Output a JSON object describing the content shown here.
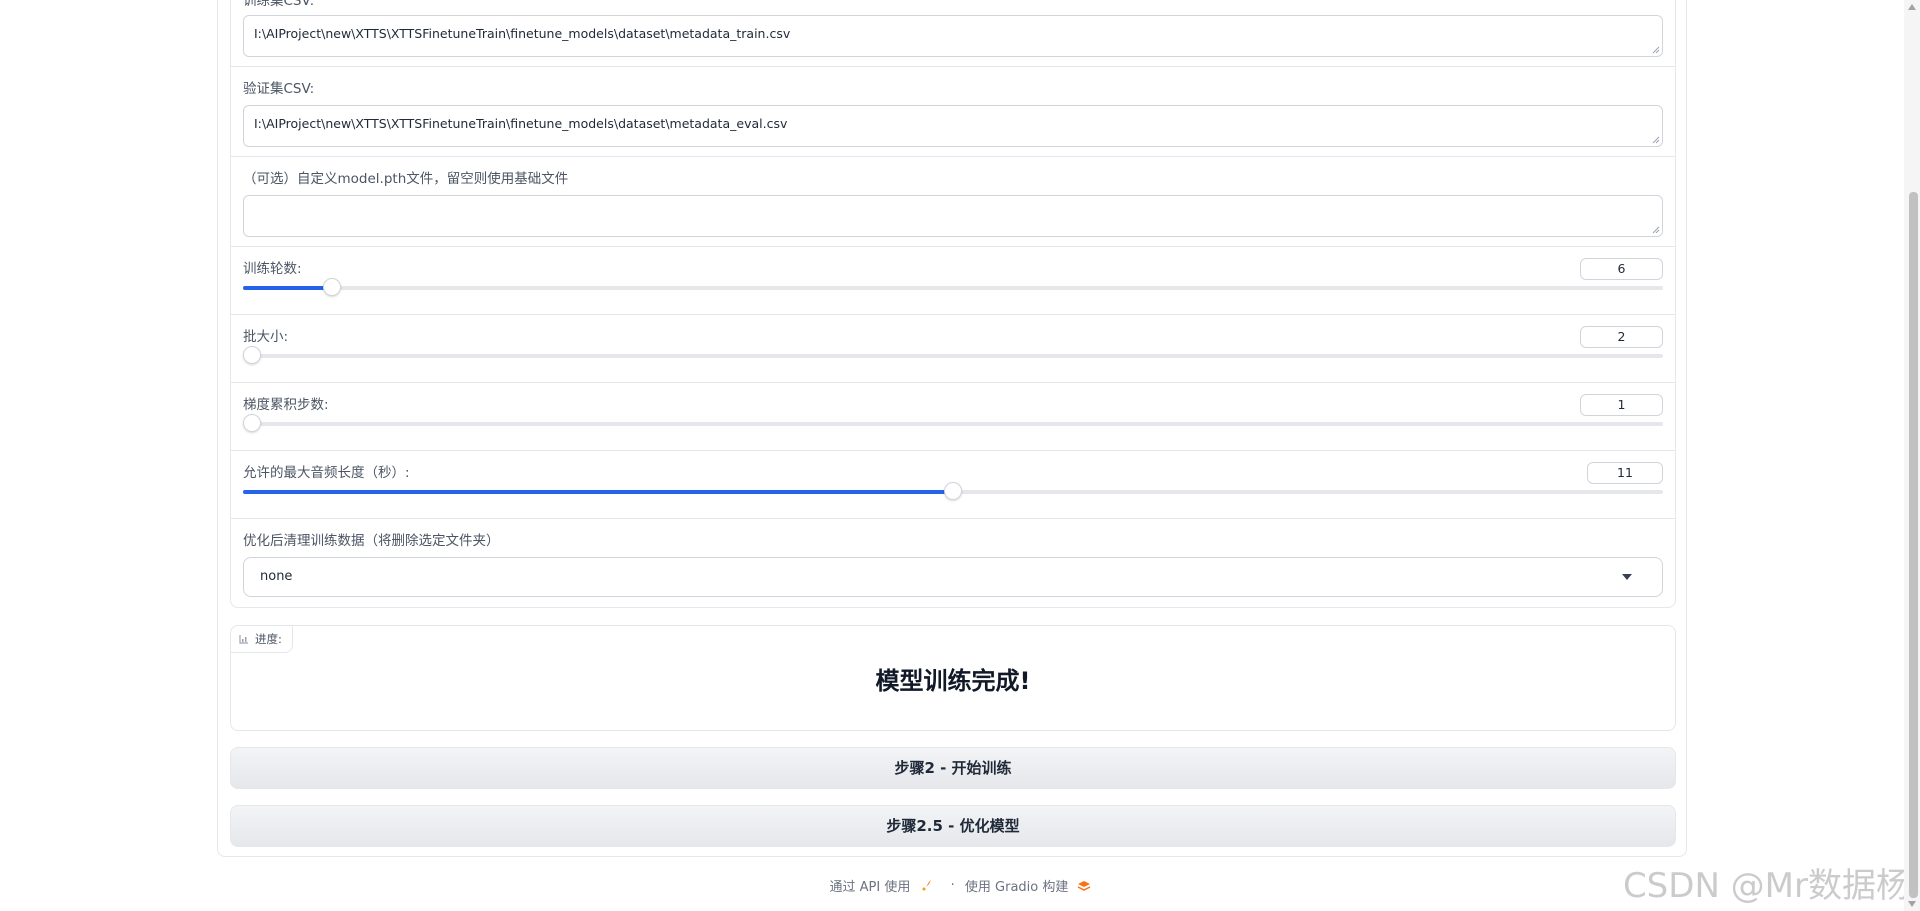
{
  "form": {
    "train_csv": {
      "label": "训练集CSV:",
      "value": "I:\\AIProject\\new\\XTTS\\XTTSFinetuneTrain\\finetune_models\\dataset\\metadata_train.csv"
    },
    "eval_csv": {
      "label": "验证集CSV:",
      "value": "I:\\AIProject\\new\\XTTS\\XTTSFinetuneTrain\\finetune_models\\dataset\\metadata_eval.csv"
    },
    "custom_model": {
      "label": "（可选）自定义model.pth文件，留空则使用基础文件",
      "value": ""
    },
    "epochs": {
      "label": "训练轮数:",
      "value": "6",
      "fraction": 0.057
    },
    "batch_size": {
      "label": "批大小:",
      "value": "2",
      "fraction": 0.0
    },
    "grad_accum": {
      "label": "梯度累积步数:",
      "value": "1",
      "fraction": 0.0
    },
    "max_audio": {
      "label": "允许的最大音频长度（秒）:",
      "value": "11",
      "fraction": 0.5
    },
    "cleanup": {
      "label": "优化后清理训练数据（将删除选定文件夹）",
      "value": "none"
    }
  },
  "progress": {
    "label": "进度:",
    "message": "模型训练完成!"
  },
  "buttons": {
    "train": "步骤2 - 开始训练",
    "optimize": "步骤2.5 - 优化模型"
  },
  "footer": {
    "api": "通过 API 使用",
    "sep": "·",
    "built": "使用 Gradio 构建"
  },
  "watermark": "CSDN @Mr数据杨"
}
